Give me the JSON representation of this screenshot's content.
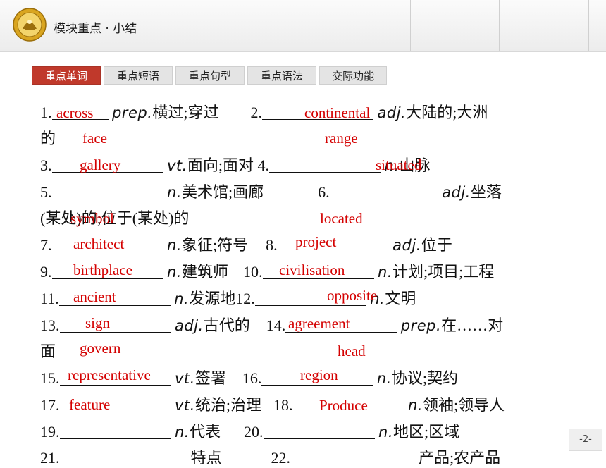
{
  "header": {
    "title": "模块重点 · 小结"
  },
  "tabs": [
    {
      "label": "重点单词",
      "active": true
    },
    {
      "label": "重点短语",
      "active": false
    },
    {
      "label": "重点句型",
      "active": false
    },
    {
      "label": "重点语法",
      "active": false
    },
    {
      "label": "交际功能",
      "active": false
    }
  ],
  "lines": {
    "l1": {
      "n1": "1.",
      "pos1": "prep.",
      "m1": "横过;穿过",
      "n2": "2.",
      "pos2": "adj.",
      "m2": "大陆的;大洲"
    },
    "l2": {
      "m": "的"
    },
    "l3": {
      "n1": "3.",
      "pos1": "vt.",
      "m1": "面向;面对",
      "n2": "4.",
      "pos2": "n.",
      "m2": "山脉"
    },
    "l4": {
      "n1": "5.",
      "pos1": "n.",
      "m1": "美术馆;画廊",
      "n2": "6.",
      "pos2": "adj.",
      "m2": "坐落"
    },
    "l5": {
      "m": "(某处)的;位于(某处)的"
    },
    "l6": {
      "n1": "7.",
      "pos1": "n.",
      "m1": "象征;符号",
      "n2": "8.",
      "pos2": "adj.",
      "m2": "位于"
    },
    "l7": {
      "n1": "9.",
      "pos1": "n.",
      "m1": "建筑师",
      "n2": "10.",
      "pos2": "n.",
      "m2": "计划;项目;工程"
    },
    "l8": {
      "n1": "11.",
      "pos1": "n.",
      "m1": "发源地",
      "n2": "12.",
      "pos2": "n.",
      "m2": "文明"
    },
    "l9": {
      "n1": "13.",
      "pos1": "adj.",
      "m1": "古代的",
      "n2": "14.",
      "pos2": "prep.",
      "m2": "在……对"
    },
    "l10": {
      "m": "面"
    },
    "l11": {
      "n1": "15.",
      "pos1": "vt.",
      "m1": "签署",
      "n2": "16.",
      "pos2": "n.",
      "m2": "协议;契约"
    },
    "l12": {
      "n1": "17.",
      "pos1": "vt.",
      "m1": "统治;治理",
      "n2": "18.",
      "pos2": "n.",
      "m2": "领袖;领导人"
    },
    "l13": {
      "n1": "19.",
      "pos1": "n.",
      "m1": "代表",
      "n2": "20.",
      "pos2": "n.",
      "m2": "地区;区域"
    },
    "l14": {
      "n1": "21.",
      "m1": "特点",
      "n2": "22.",
      "m2": "产品;农产品"
    }
  },
  "answers": {
    "across": "across",
    "continental": "continental",
    "face": "face",
    "range": "range",
    "gallery": "gallery",
    "situated": "situated",
    "symbol": "symbol",
    "located": "located",
    "architect": "architect",
    "project": "project",
    "birthplace": "birthplace",
    "civilisation": "civilisation",
    "ancient": "ancient",
    "opposite": "opposite",
    "sign": "sign",
    "agreement": "agreement",
    "govern": "govern",
    "head": "head",
    "representative": "representative",
    "region": "region",
    "feature": "feature",
    "produce": "Produce"
  },
  "page_number": "-2-",
  "colors": {
    "accent": "#c0392b",
    "answer": "#d40000"
  }
}
